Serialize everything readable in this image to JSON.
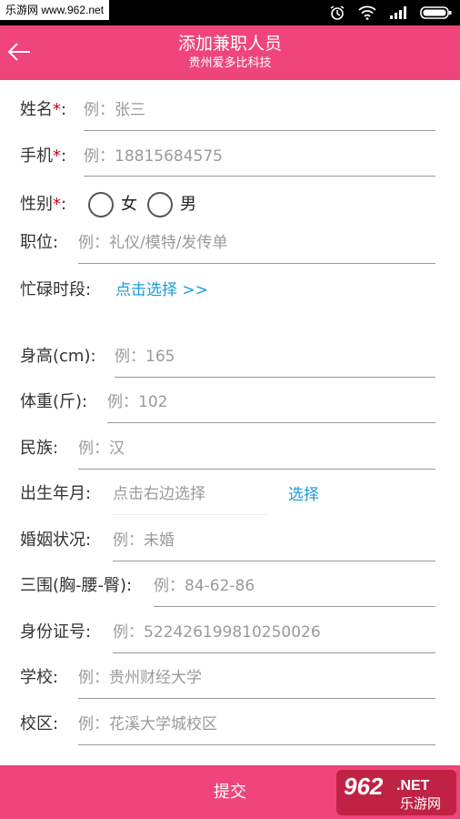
{
  "status_bar": {
    "watermark": "乐游网 www.962.net"
  },
  "header": {
    "title": "添加兼职人员",
    "subtitle": "贵州爱多比科技"
  },
  "form": {
    "name": {
      "label": "姓名",
      "required": "*",
      "colon": ":",
      "placeholder": "例：张三"
    },
    "phone": {
      "label": "手机",
      "required": "*",
      "colon": ":",
      "placeholder": "例：18815684575"
    },
    "gender": {
      "label": "性别",
      "required": "*",
      "colon": ":",
      "options": [
        "女",
        "男"
      ]
    },
    "position": {
      "label": "职位:",
      "placeholder": "例：礼仪/模特/发传单"
    },
    "busy": {
      "label": "忙碌时段:",
      "link": "点击选择 >>"
    },
    "height": {
      "label": "身高(cm):",
      "placeholder": "例：165"
    },
    "weight": {
      "label": "体重(斤):",
      "placeholder": "例：102"
    },
    "ethnicity": {
      "label": "民族:",
      "placeholder": "例：汉"
    },
    "birth": {
      "label": "出生年月:",
      "placeholder": "点击右边选择",
      "link": "选择"
    },
    "marital": {
      "label": "婚姻状况:",
      "placeholder": "例：未婚"
    },
    "measurements": {
      "label": "三围(胸-腰-臀):",
      "placeholder": "例：84-62-86"
    },
    "id_number": {
      "label": "身份证号:",
      "placeholder": "例：522426199810250026"
    },
    "school": {
      "label": "学校:",
      "placeholder": "例：贵州财经大学"
    },
    "campus": {
      "label": "校区:",
      "placeholder": "例：花溪大学城校区"
    }
  },
  "submit_label": "提交",
  "watermark_logo": {
    "number": "962",
    "suffix": ".NET",
    "text": "乐游网"
  },
  "colors": {
    "brand": "#f0457b",
    "link": "#1a9ad6",
    "required": "#d0021b"
  }
}
